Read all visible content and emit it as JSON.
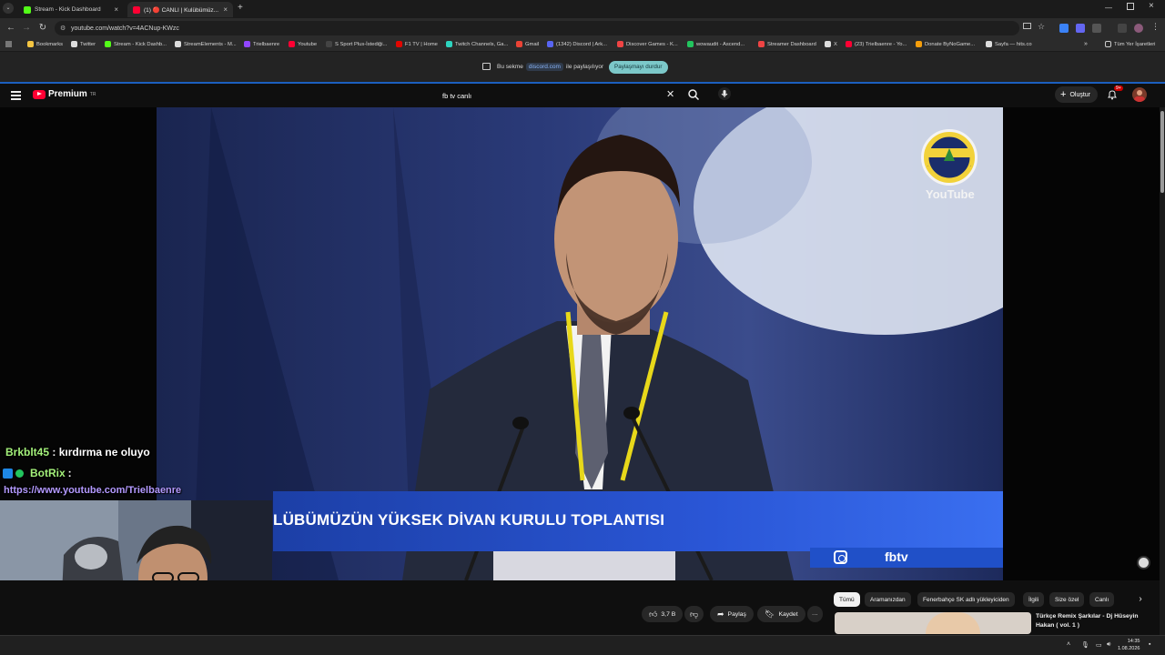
{
  "browser": {
    "tabs": [
      {
        "title": "Stream - Kick Dashboard",
        "favicon_color": "#53fc18",
        "active": false
      },
      {
        "title": "(1) 🔴 CANLI | Kulübümüz...",
        "favicon_color": "#ff0033",
        "active": true
      }
    ],
    "new_tab_label": "+",
    "url": "youtube.com/watch?v=4ACNup-KWzc",
    "bookmarks": [
      {
        "label": "Bookmarks",
        "color": "#f4c542"
      },
      {
        "label": "Twitter",
        "color": "#dddddd"
      },
      {
        "label": "Stream - Kick Dashb...",
        "color": "#53fc18"
      },
      {
        "label": "StreamElements - M...",
        "color": "#dddddd"
      },
      {
        "label": "Trielbaenre",
        "color": "#9146ff"
      },
      {
        "label": "Youtube",
        "color": "#ff0033"
      },
      {
        "label": "S Sport Plus-İstediği...",
        "color": "#444444"
      },
      {
        "label": "F1 TV | Home",
        "color": "#e10600"
      },
      {
        "label": "Twitch Channels, Ga...",
        "color": "#2dd4bf"
      },
      {
        "label": "Gmail",
        "color": "#ea4335"
      },
      {
        "label": "(1342) Discord | Ark...",
        "color": "#5865f2"
      },
      {
        "label": "Discover Games - K...",
        "color": "#ef4444"
      },
      {
        "label": "wowaudit - Ascend...",
        "color": "#22c55e"
      },
      {
        "label": "Streamer Dashboard",
        "color": "#ef4444"
      },
      {
        "label": "X",
        "color": "#dddddd"
      },
      {
        "label": "(23) Trielbaenre - Yo...",
        "color": "#ff0033"
      },
      {
        "label": "Donate ByNoGame...",
        "color": "#f59e0b"
      },
      {
        "label": "Sayfa — hits.co",
        "color": "#dddddd"
      }
    ],
    "bookmarks_overflow": "»",
    "all_bookmarks_label": "Tüm Yer İşaretleri"
  },
  "share_banner": {
    "prefix": "Bu sekme",
    "domain": "discord.com",
    "suffix": "ile paylaşılıyor",
    "stop_label": "Paylaşmayı durdur"
  },
  "youtube": {
    "logo_text": "Premium",
    "logo_region": "TR",
    "search_value": "fb tv canlı",
    "create_label": "Oluştur",
    "notification_count": "9+"
  },
  "video": {
    "lower_third_title": "LÜBÜMÜZÜN YÜKSEK DİVAN KURULU TOPLANTISI",
    "handle": "fbtv",
    "watermark_text": "YouTube"
  },
  "chat": [
    {
      "user": "Brkblt45",
      "message": ": kırdırma ne oluyo",
      "user_color": "#a3f07a"
    },
    {
      "user": "BotRix",
      "message": ":",
      "user_color": "#a3f07a"
    }
  ],
  "chat_link": "https://www.youtube.com/Trielbaenre",
  "actions": {
    "like_count": "3,7 B",
    "share_label": "Paylaş",
    "save_label": "Kaydet",
    "more_label": "···"
  },
  "chips": [
    {
      "label": "Tümü",
      "selected": true
    },
    {
      "label": "Aramanızdan",
      "selected": false
    },
    {
      "label": "Fenerbahçe SK adlı yükleyiciden",
      "selected": false
    },
    {
      "label": "İlgili",
      "selected": false
    },
    {
      "label": "Size özel",
      "selected": false
    },
    {
      "label": "Canlı",
      "selected": false
    }
  ],
  "recommendation": {
    "title": "Türkçe Remix Şarkılar - Dj Hüseyin Hakan ( vol. 1 )"
  },
  "taskbar": {
    "time": "14:35",
    "date": "1.08.2026"
  }
}
